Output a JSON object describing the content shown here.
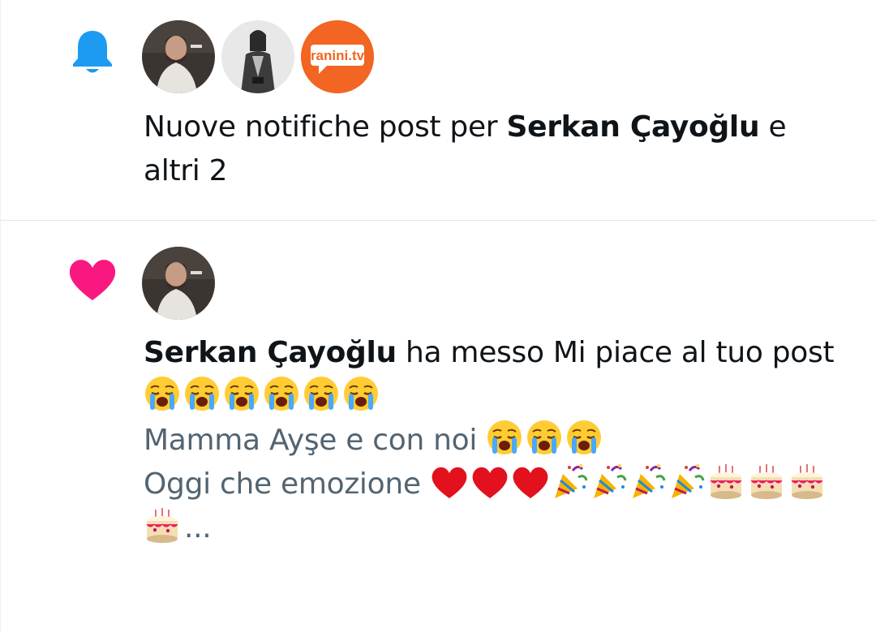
{
  "notifications": [
    {
      "type_icon": "bell-icon",
      "type_color": "#1d9bf0",
      "avatars": [
        "serkan-cayoglu-avatar",
        "woman-portrait-avatar",
        "ranini-tv-avatar"
      ],
      "ranini_logo_text": "ranini.tv",
      "text_prefix": "Nuove notifiche post per",
      "bold_name": "Serkan Çayoğlu",
      "text_suffix": "e altri 2"
    },
    {
      "type_icon": "heart-icon",
      "type_color": "#f91880",
      "avatars": [
        "serkan-cayoglu-avatar"
      ],
      "bold_name": "Serkan Çayoğlu",
      "text_suffix": "ha messo Mi piace al tuo post",
      "post_line_2": "Mamma Ayşe e con noi",
      "post_line_3": "Oggi che emozione",
      "ellipsis": "..."
    }
  ]
}
